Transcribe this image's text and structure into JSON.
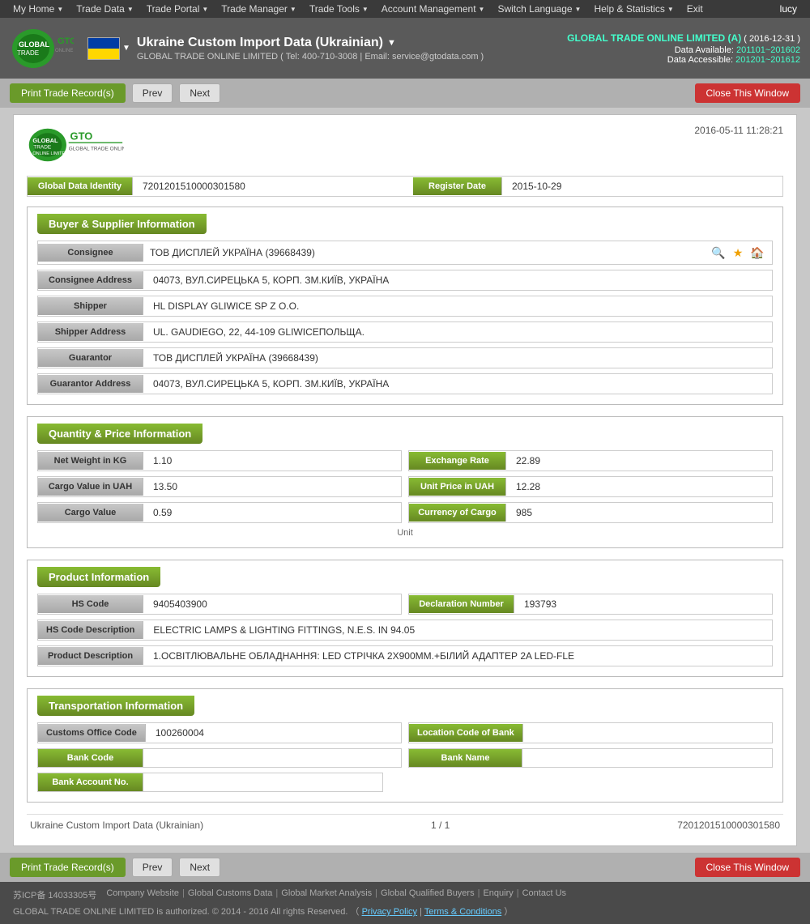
{
  "topnav": {
    "items": [
      {
        "label": "My Home",
        "id": "my-home"
      },
      {
        "label": "Trade Data",
        "id": "trade-data"
      },
      {
        "label": "Trade Portal",
        "id": "trade-portal"
      },
      {
        "label": "Trade Manager",
        "id": "trade-manager"
      },
      {
        "label": "Trade Tools",
        "id": "trade-tools"
      },
      {
        "label": "Account Management",
        "id": "account-management"
      },
      {
        "label": "Switch Language",
        "id": "switch-language"
      },
      {
        "label": "Help & Statistics",
        "id": "help-statistics"
      },
      {
        "label": "Exit",
        "id": "exit"
      }
    ],
    "user": "lucy"
  },
  "header": {
    "title": "Ukraine Custom Import Data (Ukrainian)",
    "subtitle": "GLOBAL TRADE ONLINE LIMITED ( Tel: 400-710-3008 | Email: service@gtodata.com )",
    "company": "GLOBAL TRADE ONLINE LIMITED (A)",
    "period": "( 2016-12-31 )",
    "data_available_label": "Data Available:",
    "data_available": "201101~201602",
    "data_accessible_label": "Data Accessible:",
    "data_accessible": "201201~201612"
  },
  "toolbar": {
    "print_label": "Print Trade Record(s)",
    "prev_label": "Prev",
    "next_label": "Next",
    "close_label": "Close This Window"
  },
  "record": {
    "date": "2016-05-11 11:28:21",
    "global_data_identity_label": "Global Data Identity",
    "global_data_identity_value": "7201201510000301580",
    "register_date_label": "Register Date",
    "register_date_value": "2015-10-29",
    "sections": {
      "buyer_supplier": {
        "title": "Buyer & Supplier Information",
        "fields": [
          {
            "label": "Consignee",
            "value": "ТОВ ДИСПЛЕЙ УКРАЇНА (39668439)"
          },
          {
            "label": "Consignee Address",
            "value": "04073, ВУЛ.СИРЕЦЬКА 5, КОРП. ЗМ.КИЇВ, УКРАЇНА"
          },
          {
            "label": "Shipper",
            "value": "HL DISPLAY GLIWICE SP Z O.O."
          },
          {
            "label": "Shipper Address",
            "value": "UL. GAUDIEGO, 22, 44-109 GLIWICEПОЛЬЩА."
          },
          {
            "label": "Guarantor",
            "value": "ТОВ ДИСПЛЕЙ УКРАЇНА  (39668439)"
          },
          {
            "label": "Guarantor Address",
            "value": "04073, ВУЛ.СИРЕЦЬКА 5, КОРП. ЗМ.КИЇВ, УКРАЇНА"
          }
        ]
      },
      "quantity_price": {
        "title": "Quantity & Price Information",
        "left_fields": [
          {
            "label": "Net Weight in KG",
            "value": "1.10"
          },
          {
            "label": "Cargo Value in UAH",
            "value": "13.50"
          },
          {
            "label": "Cargo Value",
            "value": "0.59"
          }
        ],
        "right_fields": [
          {
            "label": "Exchange Rate",
            "value": "22.89"
          },
          {
            "label": "Unit Price in UAH",
            "value": "12.28"
          },
          {
            "label": "Currency of Cargo",
            "value": "985"
          }
        ],
        "extra_label": "Unit"
      },
      "product": {
        "title": "Product Information",
        "fields": [
          {
            "label": "HS Code",
            "value": "9405403900",
            "label2": "Declaration Number",
            "value2": "193793"
          },
          {
            "label": "HS Code Description",
            "value": "ELECTRIC LAMPS & LIGHTING FITTINGS, N.E.S. IN 94.05"
          },
          {
            "label": "Product Description",
            "value": "1.ОСВІТЛЮВАЛЬНЕ ОБЛАДНАННЯ: LED СТРІЧКА 2Х900ММ.+БІЛИЙ АДАПТЕР 2A LED-FLE"
          }
        ]
      },
      "transportation": {
        "title": "Transportation Information",
        "fields": [
          {
            "label": "Customs Office Code",
            "value": "100260004",
            "label2": "Location Code of Bank",
            "value2": ""
          },
          {
            "label": "Bank Code",
            "value": "",
            "label2": "Bank Name",
            "value2": ""
          },
          {
            "label": "Bank Account No.",
            "value": ""
          }
        ]
      }
    },
    "footer": {
      "source": "Ukraine Custom Import Data (Ukrainian)",
      "page": "1 / 1",
      "record_id": "7201201510000301580"
    }
  },
  "bottom_toolbar": {
    "print_label": "Print Trade Record(s)",
    "prev_label": "Prev",
    "next_label": "Next",
    "close_label": "Close This Window"
  },
  "footer": {
    "icp": "苏ICP备 14033305号",
    "links": [
      {
        "label": "Company Website"
      },
      {
        "label": "Global Customs Data"
      },
      {
        "label": "Global Market Analysis"
      },
      {
        "label": "Global Qualified Buyers"
      },
      {
        "label": "Enquiry"
      },
      {
        "label": "Contact Us"
      }
    ],
    "copyright": "GLOBAL TRADE ONLINE LIMITED is authorized. © 2014 - 2016 All rights Reserved.  （",
    "privacy": "Privacy Policy",
    "separator": "|",
    "terms": "Terms & Conditions",
    "close_paren": "）"
  }
}
